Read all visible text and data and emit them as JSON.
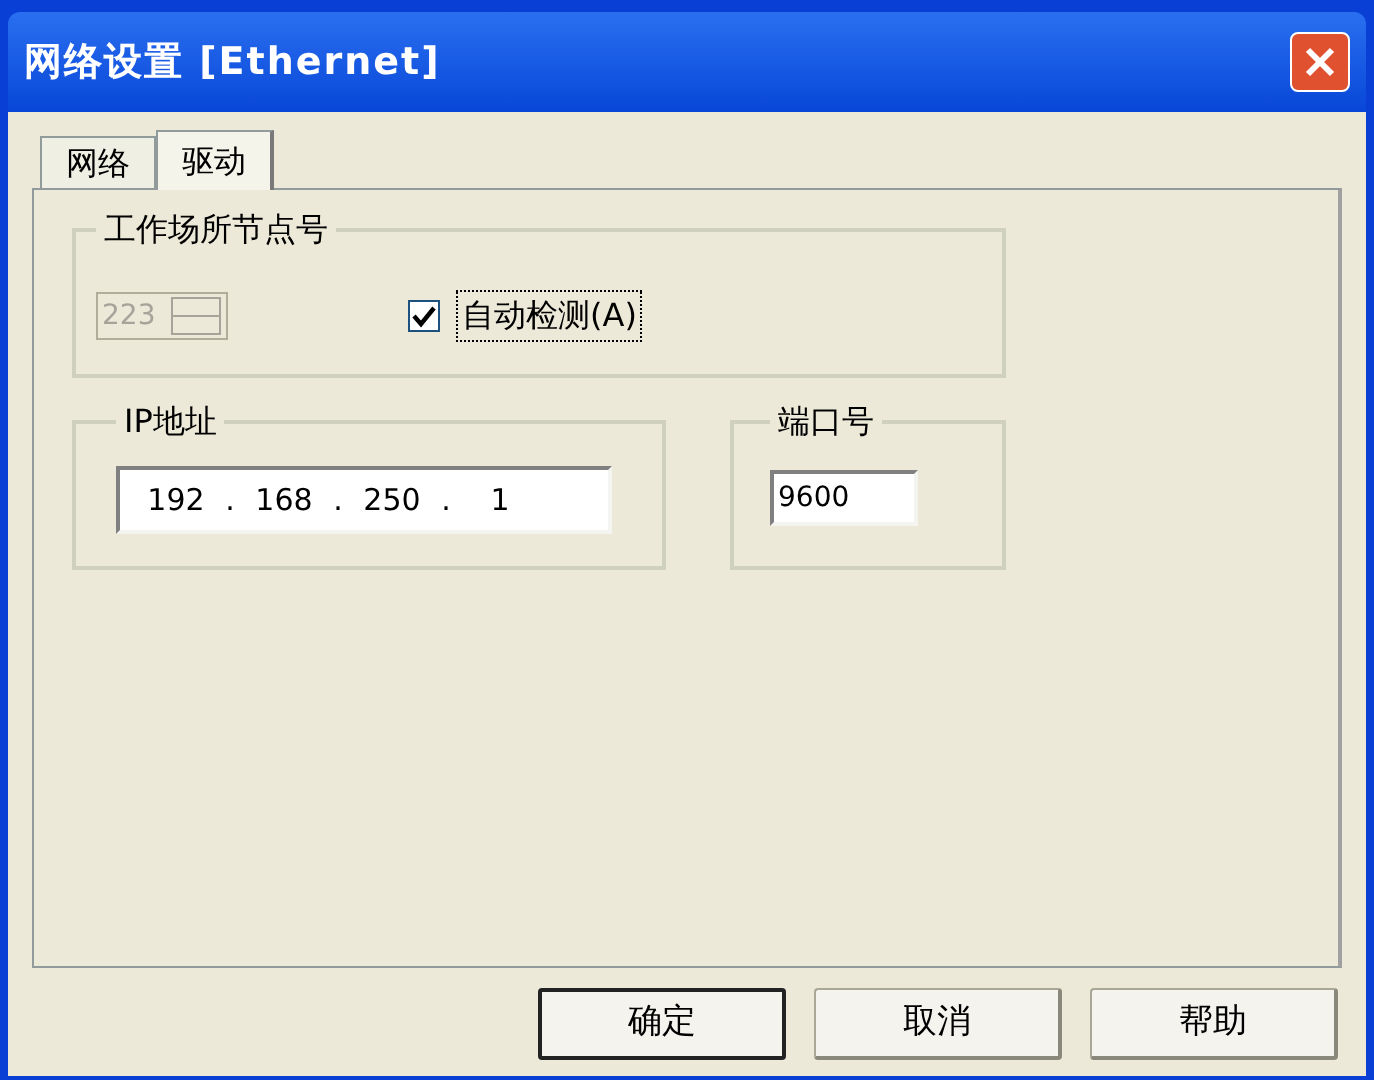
{
  "window": {
    "title": "网络设置 [Ethernet]"
  },
  "tabs": [
    {
      "label": "网络",
      "selected": false
    },
    {
      "label": "驱动",
      "selected": true
    }
  ],
  "node_group": {
    "label": "工作场所节点号",
    "spinner": {
      "value": "223",
      "disabled": true
    },
    "auto_detect": {
      "label": "自动检测(A)",
      "checked": true
    }
  },
  "ip_group": {
    "label": "IP地址",
    "octets": [
      "192",
      "168",
      "250",
      "1"
    ],
    "separator": "."
  },
  "port_group": {
    "label": "端口号",
    "value": "9600"
  },
  "buttons": [
    {
      "label": "确定",
      "default": true
    },
    {
      "label": "取消",
      "default": false
    },
    {
      "label": "帮助",
      "default": false
    }
  ]
}
